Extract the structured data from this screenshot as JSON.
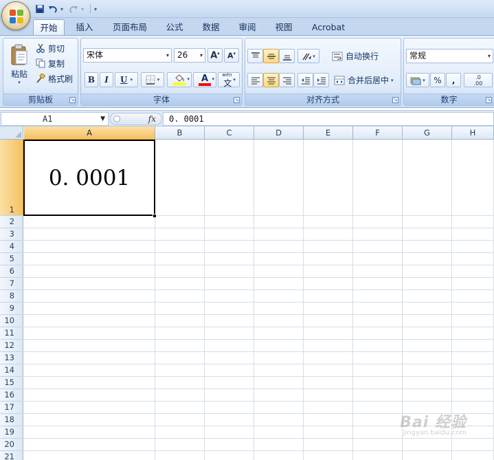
{
  "quick_access": {
    "icons": [
      "save-icon",
      "undo-icon",
      "redo-icon"
    ]
  },
  "tabs": [
    "开始",
    "插入",
    "页面布局",
    "公式",
    "数据",
    "审阅",
    "视图",
    "Acrobat"
  ],
  "clipboard": {
    "paste_label": "粘贴",
    "cut_label": "剪切",
    "copy_label": "复制",
    "format_painter_label": "格式刷",
    "group_label": "剪贴板"
  },
  "font": {
    "name": "宋体",
    "size": "26",
    "bold": "B",
    "italic": "I",
    "underline": "U",
    "font_color_glyph": "A",
    "phonetic_glyph": "文",
    "phonetic_small": "wén",
    "group_label": "字体",
    "fill_color": "#ffff00",
    "font_color": "#ff0000"
  },
  "alignment": {
    "wrap_text_label": "自动换行",
    "merge_center_label": "合并后居中",
    "group_label": "对齐方式"
  },
  "number": {
    "format": "常规",
    "percent": "%",
    "comma": ",",
    "inc_decimal_top": ".0",
    "inc_decimal_bottom": ".00",
    "group_label": "数字"
  },
  "formula_bar": {
    "name_box": "A1",
    "fx_label": "fx",
    "value": "0. 0001"
  },
  "grid": {
    "columns": [
      "A",
      "B",
      "C",
      "D",
      "E",
      "F",
      "G",
      "H"
    ],
    "rows": [
      "1",
      "2",
      "3",
      "4",
      "5",
      "6",
      "7",
      "8",
      "9",
      "10",
      "11",
      "12",
      "13",
      "14",
      "15",
      "16",
      "17",
      "18",
      "19",
      "20",
      "21"
    ],
    "active_cell_value": "0. 0001"
  },
  "watermark": {
    "main": "Bai 经验",
    "sub": "jingyan.baidu.com"
  }
}
